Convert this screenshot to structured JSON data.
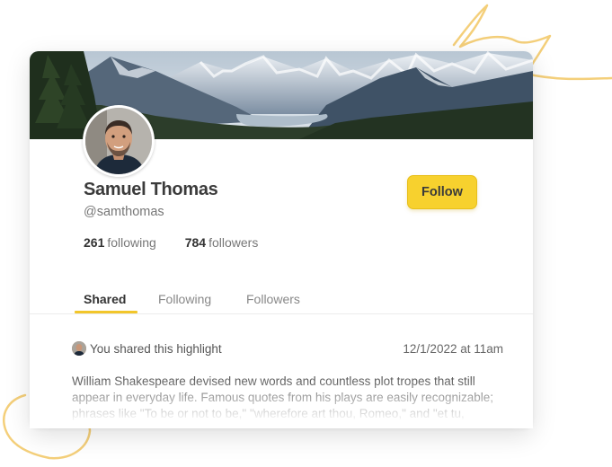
{
  "profile": {
    "name": "Samuel Thomas",
    "handle": "@samthomas",
    "following_count": "261",
    "following_label": "following",
    "followers_count": "784",
    "followers_label": "followers",
    "follow_label": "Follow"
  },
  "tabs": [
    {
      "label": "Shared",
      "active": true
    },
    {
      "label": "Following",
      "active": false
    },
    {
      "label": "Followers",
      "active": false
    }
  ],
  "feed": {
    "shared_label": "You shared this highlight",
    "timestamp": "12/1/2022 at 11am",
    "excerpt": "William Shakespeare devised new words and countless plot tropes that still appear in everyday life. Famous quotes from his plays are easily recognizable; phrases like \"To be or not to be,\" \"wherefore art thou, Romeo,\" and \"et tu, Brute?\" exist today alongside many of his characters, plots, and Elizabethan turns of phrase."
  },
  "colors": {
    "accent": "#f7d12e",
    "doodle": "#f4cf7a"
  },
  "icons": {
    "avatar": "profile-photo",
    "banner": "mountain-landscape-banner"
  }
}
